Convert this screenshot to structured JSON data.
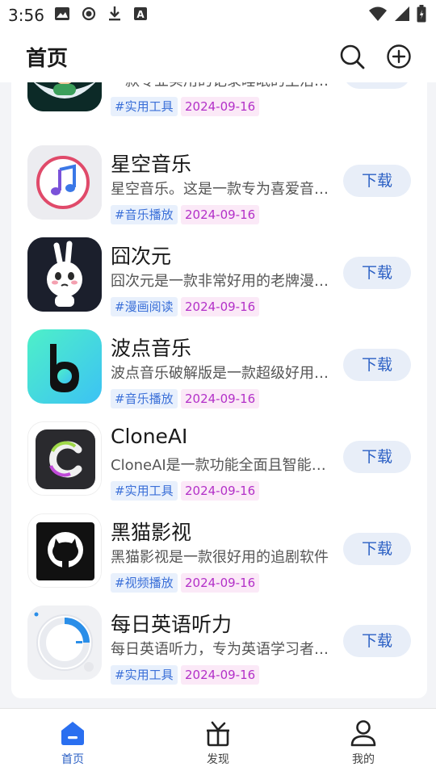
{
  "status_bar": {
    "time": "3:56",
    "left_icons": [
      "image-icon",
      "record-icon",
      "download-icon",
      "a-badge-icon"
    ],
    "right_icons": [
      "wifi-icon",
      "signal-icon",
      "battery-icon"
    ]
  },
  "app_bar": {
    "title": "首页",
    "actions": [
      "search-icon",
      "add-circle-icon"
    ]
  },
  "apps": [
    {
      "name": "",
      "desc": "一款专业实用的记录睡眠的生活工具",
      "tag": "#实用工具",
      "date": "2024-09-16",
      "button": "下载",
      "icon": "sleep-moon-icon"
    },
    {
      "name": "星空音乐",
      "desc": "星空音乐。这是一款专为喜爱音乐的用户",
      "tag": "#音乐播放",
      "date": "2024-09-16",
      "button": "下载",
      "icon": "music-note-icon"
    },
    {
      "name": "囧次元",
      "desc": "囧次元是一款非常好用的老牌漫画软件",
      "tag": "#漫画阅读",
      "date": "2024-09-16",
      "button": "下载",
      "icon": "rabbit-mascot-icon"
    },
    {
      "name": "波点音乐",
      "desc": "波点音乐破解版是一款超级好用的音乐",
      "tag": "#音乐播放",
      "date": "2024-09-16",
      "button": "下载",
      "icon": "bodian-b-icon"
    },
    {
      "name": "CloneAI",
      "desc": "CloneAI是一款功能全面且智能的工具",
      "tag": "#实用工具",
      "date": "2024-09-16",
      "button": "下载",
      "icon": "clone-c-icon"
    },
    {
      "name": "黑猫影视",
      "desc": "黑猫影视是一款很好用的追剧软件",
      "tag": "#视频播放",
      "date": "2024-09-16",
      "button": "下载",
      "icon": "github-cat-icon"
    },
    {
      "name": "每日英语听力",
      "desc": "每日英语听力，专为英语学习者打造",
      "tag": "#实用工具",
      "date": "2024-09-16",
      "button": "下载",
      "icon": "dial-ring-icon"
    }
  ],
  "tabs": [
    {
      "label": "首页",
      "icon": "home-icon",
      "active": true
    },
    {
      "label": "发现",
      "icon": "gift-box-icon",
      "active": false
    },
    {
      "label": "我的",
      "icon": "person-icon",
      "active": false
    }
  ],
  "colors": {
    "accent": "#2a5fc4",
    "tag_bg": "#e8f0fc",
    "tag_text": "#3a6fd8",
    "date_bg": "#fbe9f7",
    "date_text": "#b330c8",
    "button_bg": "#e8eef8"
  }
}
